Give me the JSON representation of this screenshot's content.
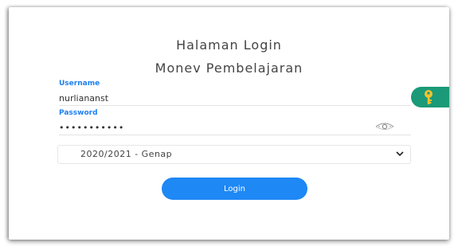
{
  "header": {
    "title_line1": "Halaman Login",
    "title_line2": "Monev Pembelajaran"
  },
  "form": {
    "username_label": "Username",
    "username_value": "nurliananst",
    "password_label": "Password",
    "password_value": "•••••••••••",
    "semester_selected": "2020/2021 - Genap",
    "login_label": "Login"
  },
  "icons": {
    "password_toggle": "eye-icon",
    "password_manager": "key-icon",
    "select_arrow": "chevron-down-icon"
  },
  "colors": {
    "accent": "#1e88f5",
    "label": "#1e7ff0",
    "key_badge": "#1a9a78",
    "key": "#f2c230"
  }
}
